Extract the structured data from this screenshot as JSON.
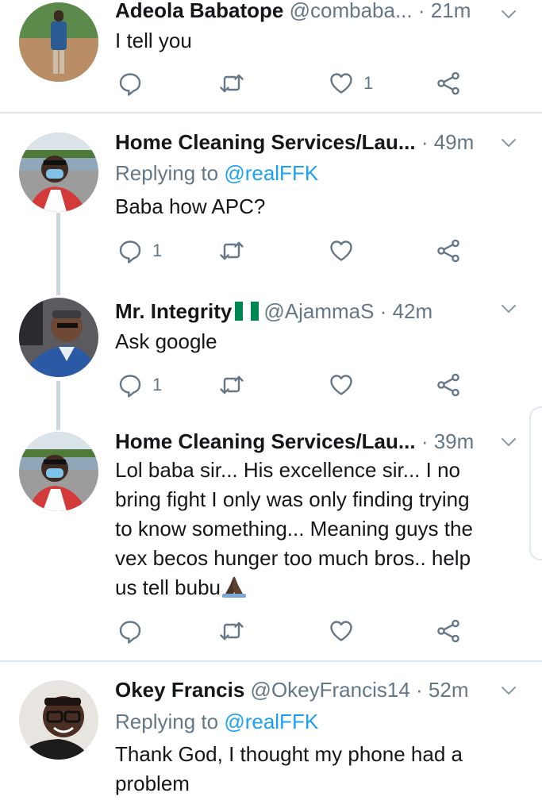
{
  "tweets": [
    {
      "name": "Adeola Babatope",
      "handle": "@combaba...",
      "dot": "·",
      "time": "21m",
      "replying_prefix": "",
      "replying_mention": "",
      "text": "I tell you",
      "reply_count": "",
      "retweet_count": "",
      "like_count": "1"
    },
    {
      "name": "Home Cleaning Services/Lau...",
      "handle": "",
      "dot": "·",
      "time": "49m",
      "replying_prefix": "Replying to",
      "replying_mention": "@realFFK",
      "text": "Baba how APC?",
      "reply_count": "1",
      "retweet_count": "",
      "like_count": ""
    },
    {
      "name": "Mr. Integrity",
      "handle": "@AjammaS",
      "dot": "·",
      "time": "42m",
      "replying_prefix": "",
      "replying_mention": "",
      "text": "Ask google",
      "reply_count": "1",
      "retweet_count": "",
      "like_count": ""
    },
    {
      "name": "Home Cleaning Services/Lau...",
      "handle": "",
      "dot": "·",
      "time": "39m",
      "replying_prefix": "",
      "replying_mention": "",
      "text_lines": [
        "Lol baba sir... His excellence sir... I no",
        "bring fight I only was only finding trying",
        "to know something... Meaning guys the",
        "vex becos hunger too much bros.. help",
        "us tell bubu"
      ],
      "reply_count": "",
      "retweet_count": "",
      "like_count": ""
    },
    {
      "name": "Okey Francis",
      "handle": "@OkeyFrancis14",
      "dot": "·",
      "time": "52m",
      "replying_prefix": "Replying to",
      "replying_mention": "@realFFK",
      "text_lines": [
        "Thank God, I thought my phone had a",
        "problem"
      ]
    }
  ],
  "icons": {
    "reply": "reply-icon",
    "retweet": "retweet-icon",
    "like": "heart-icon",
    "share": "share-icon",
    "caret": "chevron-down-icon",
    "flag": "nigeria-flag-icon",
    "emoji": "praying-hands-emoji"
  },
  "colors": {
    "text": "#14171a",
    "muted": "#657786",
    "link": "#1da1f2",
    "divider": "#e1e8ed",
    "thread_line": "#ccd6dd",
    "flag_green": "#008751"
  }
}
